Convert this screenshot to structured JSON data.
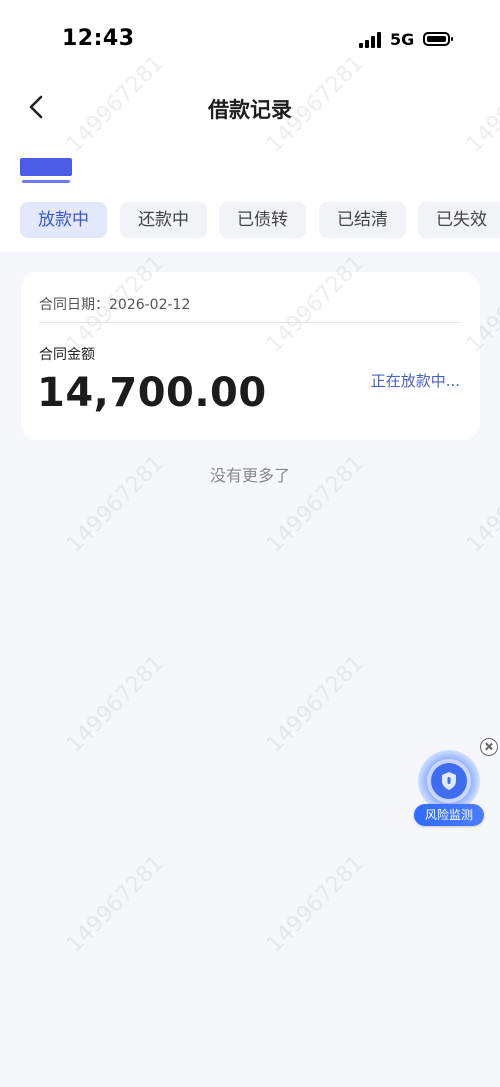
{
  "status_bar": {
    "time": "12:43",
    "network": "5G"
  },
  "header": {
    "title": "借款记录"
  },
  "tabs": [
    {
      "label": "放款中",
      "active": true
    },
    {
      "label": "还款中",
      "active": false
    },
    {
      "label": "已债转",
      "active": false
    },
    {
      "label": "已结清",
      "active": false
    },
    {
      "label": "已失效",
      "active": false
    }
  ],
  "record": {
    "contract_date": "合同日期：2026-02-12",
    "amount_label": "合同金额",
    "amount": "14,700.00",
    "status": "正在放款中..."
  },
  "list_footer": "没有更多了",
  "risk_widget": {
    "label": "风险监测"
  },
  "watermark": "149967281",
  "colors": {
    "accent": "#3b56cf",
    "active_tab_bg": "#e3e9fb",
    "widget_blue": "#2f6bff"
  }
}
